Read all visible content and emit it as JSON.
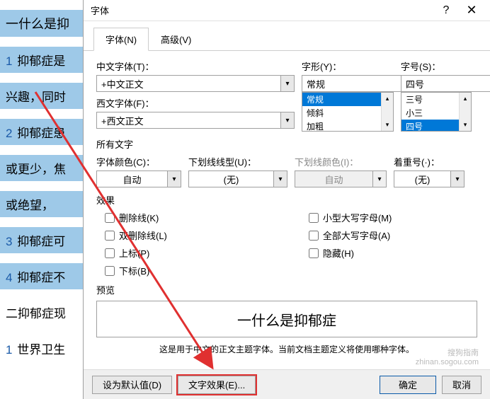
{
  "document": {
    "title": "一什么是抑",
    "lines": [
      {
        "num": "1",
        "text": "抑郁症是"
      },
      {
        "num": "",
        "text": "兴趣，同时"
      },
      {
        "num": "2",
        "text": "抑郁症患"
      },
      {
        "num": "",
        "text": "或更少，焦"
      },
      {
        "num": "",
        "text": "或绝望，"
      },
      {
        "num": "3",
        "text": "抑郁症可"
      },
      {
        "num": "4",
        "text": "抑郁症不"
      }
    ],
    "plain1": "二抑郁症现",
    "plain2_num": "1",
    "plain2": "世界卫生"
  },
  "dialog": {
    "title": "字体",
    "tabs": {
      "font": "字体(N)",
      "advanced": "高级(V)"
    },
    "chineseFontLabel": "中文字体(T)：",
    "chineseFontValue": "+中文正文",
    "westernFontLabel": "西文字体(F)：",
    "westernFontValue": "+西文正文",
    "styleLabel": "字形(Y)：",
    "styleValue": "常规",
    "styleOptions": [
      "常规",
      "倾斜",
      "加粗"
    ],
    "sizeLabel": "字号(S)：",
    "sizeValue": "四号",
    "sizeOptions": [
      "三号",
      "小三",
      "四号"
    ],
    "allTextLabel": "所有文字",
    "fontColorLabel": "字体颜色(C)：",
    "fontColorValue": "自动",
    "underlineLabel": "下划线线型(U)：",
    "underlineValue": "(无)",
    "underlineColorLabel": "下划线颜色(I)：",
    "underlineColorValue": "自动",
    "emphasisLabel": "着重号(·)：",
    "emphasisValue": "(无)",
    "effectsLabel": "效果",
    "effects": {
      "strike": "删除线(K)",
      "dstrike": "双删除线(L)",
      "super": "上标(P)",
      "sub": "下标(B)",
      "smallcaps": "小型大写字母(M)",
      "allcaps": "全部大写字母(A)",
      "hidden": "隐藏(H)"
    },
    "previewLabel": "预览",
    "previewText": "一什么是抑郁症",
    "previewNote": "这是用于中文的正文主题字体。当前文档主题定义将使用哪种字体。",
    "buttons": {
      "default": "设为默认值(D)",
      "textEffects": "文字效果(E)...",
      "ok": "确定",
      "cancel": "取消"
    }
  },
  "watermark": {
    "line1": "搜狗指南",
    "line2": "zhinan.sogou.com"
  }
}
